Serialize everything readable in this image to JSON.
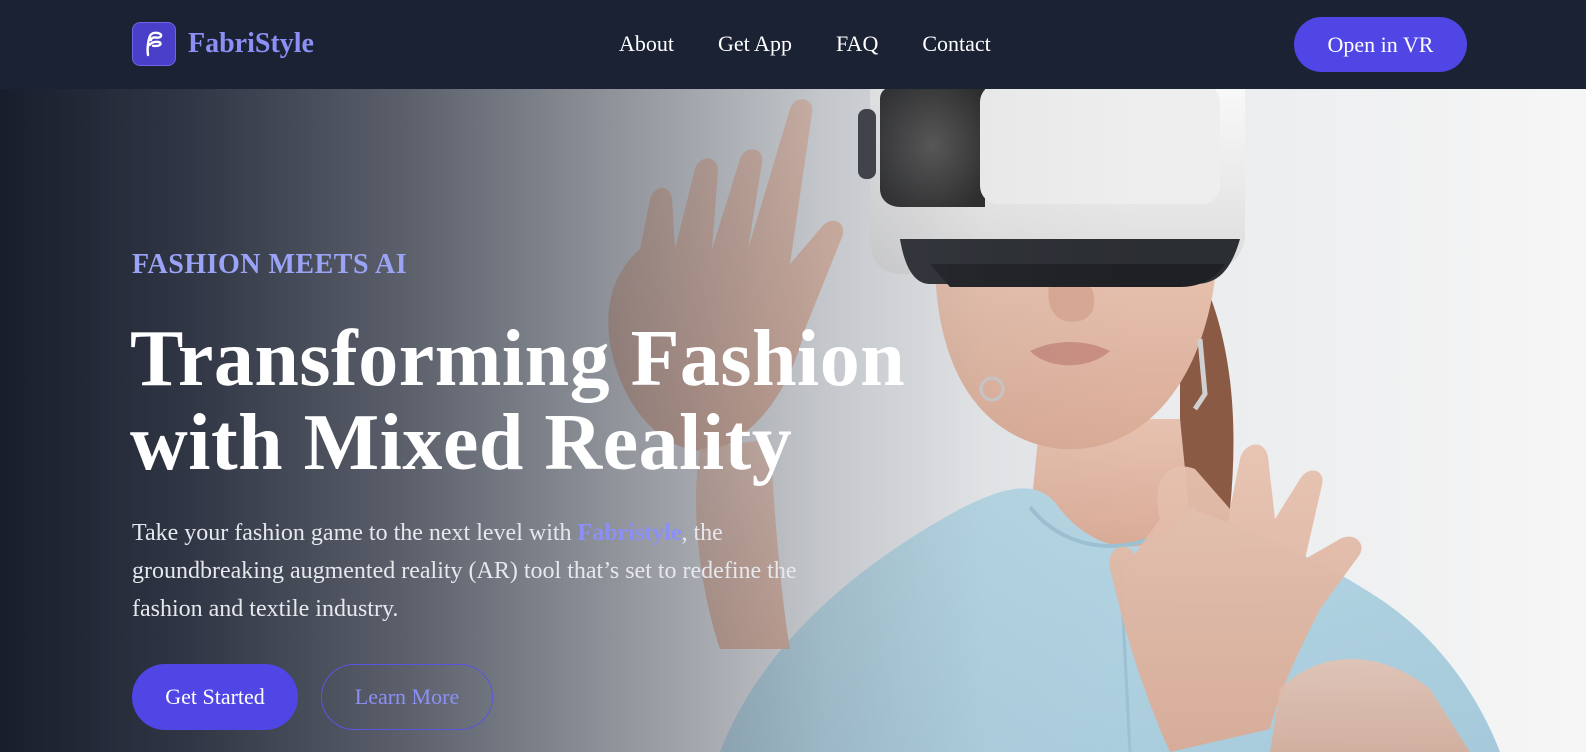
{
  "brand": {
    "name": "FabriStyle",
    "logo_icon": "fabric-f-icon",
    "accent_color": "#8c90f6"
  },
  "nav": {
    "links": [
      {
        "label": "About"
      },
      {
        "label": "Get App"
      },
      {
        "label": "FAQ"
      },
      {
        "label": "Contact"
      }
    ],
    "cta_label": "Open in VR"
  },
  "hero": {
    "eyebrow": "FASHION MEETS AI",
    "headline_line1": "Transforming Fashion",
    "headline_line2": "with Mixed Reality",
    "intro_before": "Take your fashion game to the next level with ",
    "intro_highlight": "Fabristyle",
    "intro_after": ", the groundbreaking augmented reality (AR) tool that’s set to redefine the fashion and textile industry.",
    "primary_button": "Get Started",
    "secondary_button": "Learn More",
    "image_subject": "woman-wearing-vr-headset-photo"
  },
  "colors": {
    "primary": "#4f46e5",
    "nav_background": "#1b2234",
    "eyebrow": "#9aa3f6"
  }
}
